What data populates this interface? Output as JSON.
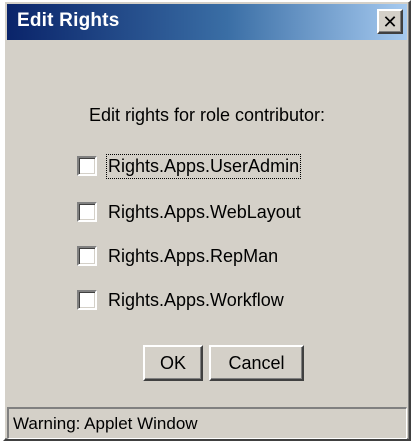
{
  "window": {
    "title": "Edit Rights",
    "close_glyph": "✕"
  },
  "prompt": "Edit rights for role contributor:",
  "options": [
    {
      "label": "Rights.Apps.UserAdmin",
      "checked": false,
      "focused": true
    },
    {
      "label": "Rights.Apps.WebLayout",
      "checked": false
    },
    {
      "label": "Rights.Apps.RepMan",
      "checked": false
    },
    {
      "label": "Rights.Apps.Workflow",
      "checked": false
    }
  ],
  "buttons": {
    "ok": "OK",
    "cancel": "Cancel"
  },
  "status": "Warning: Applet Window"
}
